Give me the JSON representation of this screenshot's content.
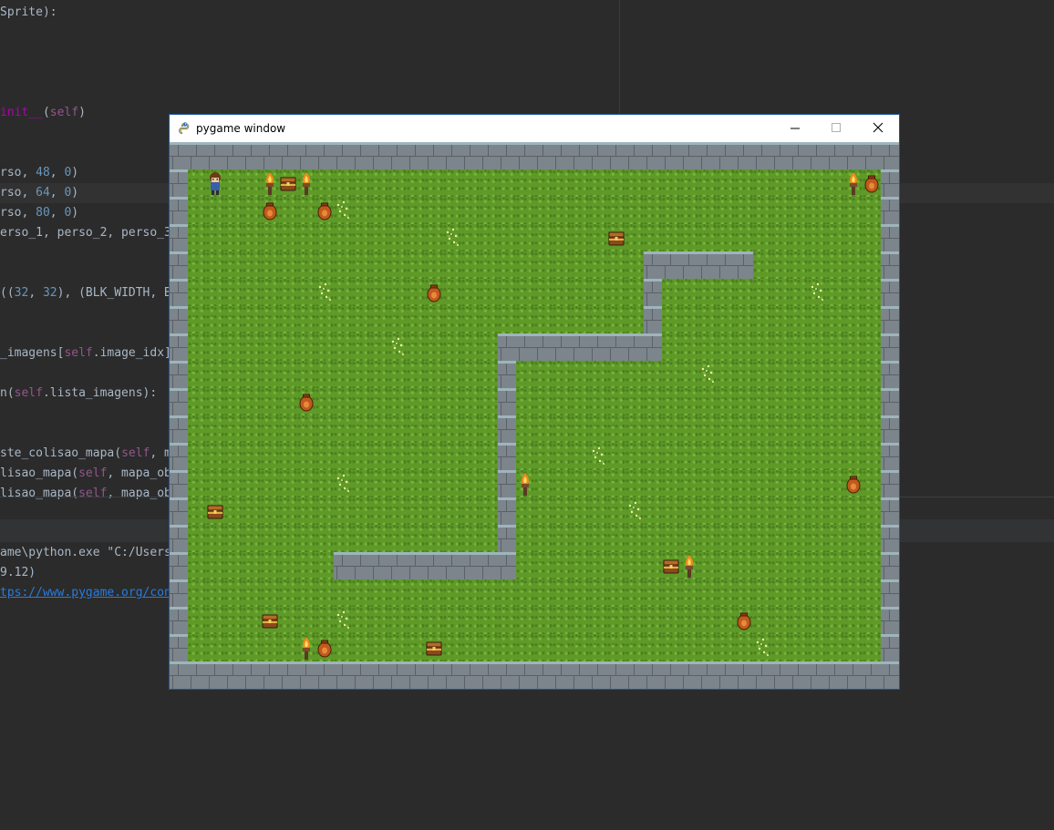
{
  "ide": {
    "code_lines": [
      {
        "segments": [
          {
            "t": "Sprite):",
            "c": ""
          }
        ]
      },
      {
        "segments": [
          {
            "t": "init__",
            "c": "fn"
          },
          {
            "t": "(",
            "c": ""
          },
          {
            "t": "self",
            "c": "self"
          },
          {
            "t": ")",
            "c": ""
          }
        ]
      },
      {
        "segments": [
          {
            "t": "rso, ",
            "c": ""
          },
          {
            "t": "48",
            "c": "num"
          },
          {
            "t": ", ",
            "c": ""
          },
          {
            "t": "0",
            "c": "num"
          },
          {
            "t": ")",
            "c": ""
          }
        ]
      },
      {
        "segments": [
          {
            "t": "rso, ",
            "c": ""
          },
          {
            "t": "64",
            "c": "num"
          },
          {
            "t": ", ",
            "c": ""
          },
          {
            "t": "0",
            "c": "num"
          },
          {
            "t": ")",
            "c": ""
          }
        ]
      },
      {
        "segments": [
          {
            "t": "rso, ",
            "c": ""
          },
          {
            "t": "80",
            "c": "num"
          },
          {
            "t": ", ",
            "c": ""
          },
          {
            "t": "0",
            "c": "num"
          },
          {
            "t": ")",
            "c": ""
          }
        ]
      },
      {
        "segments": [
          {
            "t": "erso_1, perso_2, perso_3",
            "c": ""
          }
        ]
      },
      {
        "segments": [
          {
            "t": "((",
            "c": ""
          },
          {
            "t": "32",
            "c": "num"
          },
          {
            "t": ", ",
            "c": ""
          },
          {
            "t": "32",
            "c": "num"
          },
          {
            "t": "), (BLK_WIDTH, BLK",
            "c": ""
          }
        ]
      },
      {
        "segments": [
          {
            "t": "_imagens[",
            "c": ""
          },
          {
            "t": "self",
            "c": "self"
          },
          {
            "t": ".image_idx]",
            "c": ""
          }
        ]
      },
      {
        "segments": [
          {
            "t": "n(",
            "c": ""
          },
          {
            "t": "self",
            "c": "self"
          },
          {
            "t": ".lista_imagens):",
            "c": ""
          }
        ]
      },
      {
        "segments": [
          {
            "t": "ste_colisao_mapa(",
            "c": ""
          },
          {
            "t": "self",
            "c": "self"
          },
          {
            "t": ", ma",
            "c": ""
          }
        ]
      },
      {
        "segments": [
          {
            "t": "lisao_mapa(",
            "c": ""
          },
          {
            "t": "self",
            "c": "self"
          },
          {
            "t": ", mapa_obs",
            "c": ""
          }
        ]
      },
      {
        "segments": [
          {
            "t": "lisao_mapa(",
            "c": ""
          },
          {
            "t": "self",
            "c": "self"
          },
          {
            "t": ", mapa_obs",
            "c": ""
          }
        ]
      }
    ],
    "console_lines": [
      {
        "segments": [
          {
            "t": "ame\\python.exe \"C:/Users/",
            "c": ""
          }
        ]
      },
      {
        "segments": [
          {
            "t": "9.12)",
            "c": ""
          }
        ]
      },
      {
        "segments": [
          {
            "t": "tps://www.pygame.org/cont",
            "c": "link"
          }
        ]
      }
    ]
  },
  "window": {
    "title": "pygame window",
    "icon": "pygame-snake-icon",
    "buttons": [
      "minimize-icon",
      "maximize-icon",
      "close-icon"
    ]
  },
  "game": {
    "grid_cols": 40,
    "grid_rows": 20,
    "map": [
      "WWWWWWWWWWWWWWWWWWWWWWWWWWWWWWWWWWWWWWWW",
      "W.....................................W",
      "W......................................W",
      "W......................................W",
      "W...................................WWWWWW.............W",
      "W...........................W..........W",
      "W...........................W..........W",
      "W.................WWWWWWWWWW...........W",
      "W.................W....................W",
      "W.................W....................W",
      "W.................W....................W",
      "W.................W....................W",
      "W.................W....................W",
      "W.................W....................W",
      "W.................W....................W",
      "W........WWWWWWWWWW....................W",
      "W......................................W",
      "W......................................W",
      "W......................................W",
      "WWWWWWWWWWWWWWWWWWWWWWWWWWWWWWWWWWWWWWWW"
    ],
    "walls": {
      "border": true,
      "segments": [
        {
          "row": 4,
          "cols": [
            26,
            31
          ]
        },
        {
          "row": 5,
          "cols": [
            26,
            26
          ]
        },
        {
          "row": 6,
          "cols": [
            26,
            26
          ]
        },
        {
          "row": 7,
          "cols": [
            18,
            26
          ]
        },
        {
          "col": 18,
          "rows": [
            8,
            14
          ]
        },
        {
          "row": 15,
          "cols": [
            9,
            18
          ]
        }
      ]
    },
    "player": {
      "icon": "player-character-icon",
      "col": 2,
      "row": 1
    },
    "objects": [
      {
        "type": "torch",
        "icon": "torch-icon",
        "col": 5,
        "row": 1
      },
      {
        "type": "chest",
        "icon": "chest-icon",
        "col": 6,
        "row": 1
      },
      {
        "type": "torch",
        "icon": "torch-icon",
        "col": 7,
        "row": 1
      },
      {
        "type": "torch",
        "icon": "torch-icon",
        "col": 37,
        "row": 1
      },
      {
        "type": "pot",
        "icon": "pot-icon",
        "col": 38,
        "row": 1
      },
      {
        "type": "pot",
        "icon": "pot-icon",
        "col": 5,
        "row": 2
      },
      {
        "type": "pot",
        "icon": "pot-icon",
        "col": 8,
        "row": 2
      },
      {
        "type": "flowers",
        "icon": "flowers-icon",
        "col": 9,
        "row": 2
      },
      {
        "type": "flowers",
        "icon": "flowers-icon",
        "col": 15,
        "row": 3
      },
      {
        "type": "chest",
        "icon": "chest-icon",
        "col": 24,
        "row": 3
      },
      {
        "type": "flowers",
        "icon": "flowers-icon",
        "col": 8,
        "row": 5
      },
      {
        "type": "pot",
        "icon": "pot-icon",
        "col": 14,
        "row": 5
      },
      {
        "type": "flowers",
        "icon": "flowers-icon",
        "col": 35,
        "row": 5
      },
      {
        "type": "flowers",
        "icon": "flowers-icon",
        "col": 12,
        "row": 7
      },
      {
        "type": "flowers",
        "icon": "flowers-icon",
        "col": 29,
        "row": 8
      },
      {
        "type": "pot",
        "icon": "pot-icon",
        "col": 7,
        "row": 9
      },
      {
        "type": "flowers",
        "icon": "flowers-icon",
        "col": 23,
        "row": 11
      },
      {
        "type": "flowers",
        "icon": "flowers-icon",
        "col": 9,
        "row": 12
      },
      {
        "type": "torch",
        "icon": "torch-icon",
        "col": 19,
        "row": 12
      },
      {
        "type": "pot",
        "icon": "pot-icon",
        "col": 37,
        "row": 12
      },
      {
        "type": "chest",
        "icon": "chest-icon",
        "col": 2,
        "row": 13
      },
      {
        "type": "flowers",
        "icon": "flowers-icon",
        "col": 25,
        "row": 13
      },
      {
        "type": "chest",
        "icon": "chest-icon",
        "col": 27,
        "row": 15
      },
      {
        "type": "torch",
        "icon": "torch-icon",
        "col": 28,
        "row": 15
      },
      {
        "type": "chest",
        "icon": "chest-icon",
        "col": 5,
        "row": 17
      },
      {
        "type": "flowers",
        "icon": "flowers-icon",
        "col": 9,
        "row": 17
      },
      {
        "type": "pot",
        "icon": "pot-icon",
        "col": 31,
        "row": 17
      },
      {
        "type": "torch",
        "icon": "torch-icon",
        "col": 7,
        "row": 18
      },
      {
        "type": "pot",
        "icon": "pot-icon",
        "col": 8,
        "row": 18
      },
      {
        "type": "chest",
        "icon": "chest-icon",
        "col": 14,
        "row": 18
      },
      {
        "type": "flowers",
        "icon": "flowers-icon",
        "col": 32,
        "row": 18
      }
    ]
  }
}
